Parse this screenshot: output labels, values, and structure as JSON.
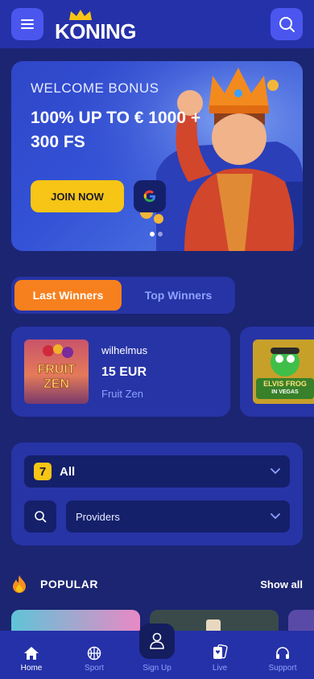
{
  "header": {
    "logo_text": "KONING"
  },
  "hero": {
    "welcome": "WELCOME BONUS",
    "headline": "100% UP TO € 1000 + 300 FS",
    "join_label": "JOIN NOW",
    "google_letter": "G"
  },
  "tabs": [
    {
      "label": "Last Winners",
      "active": true
    },
    {
      "label": "Top Winners",
      "active": false
    }
  ],
  "winners": [
    {
      "user": "wilhelmus",
      "amount": "15 EUR",
      "game": "Fruit Zen",
      "thumb_text": "FRUIT ZEN"
    },
    {
      "thumb_text": "ELVIS FROG IN VEGAS"
    }
  ],
  "filters": {
    "category_icon": "7",
    "category_label": "All",
    "providers_label": "Providers"
  },
  "popular": {
    "title": "POPULAR",
    "show_all": "Show all"
  },
  "nav": [
    {
      "label": "Home",
      "icon": "home-icon"
    },
    {
      "label": "Sport",
      "icon": "basketball-icon"
    },
    {
      "label": "Sign Up",
      "icon": "user-icon"
    },
    {
      "label": "Live",
      "icon": "cards-icon"
    },
    {
      "label": "Support",
      "icon": "headset-icon"
    }
  ],
  "colors": {
    "accent_orange": "#f7801e",
    "accent_yellow": "#f6c515",
    "bg": "#1b2572",
    "panel": "#2734a6"
  }
}
